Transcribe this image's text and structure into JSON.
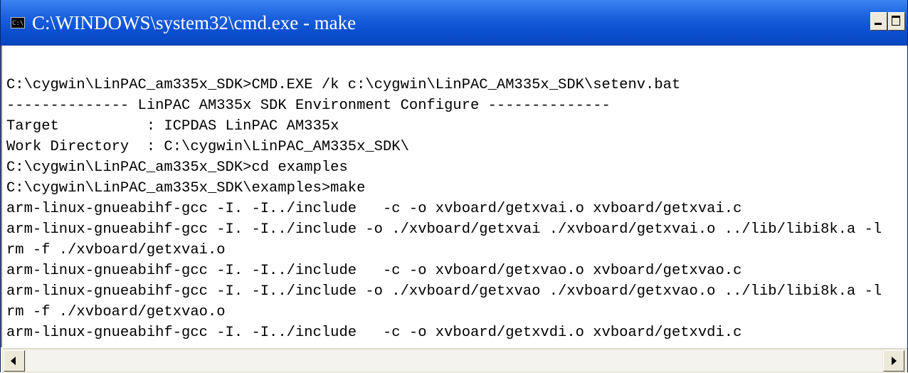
{
  "window": {
    "title": "C:\\WINDOWS\\system32\\cmd.exe - make",
    "icon_text": "C:\\"
  },
  "console": {
    "lines": [
      "",
      "C:\\cygwin\\LinPAC_am335x_SDK>CMD.EXE /k c:\\cygwin\\LinPAC_AM335x_SDK\\setenv.bat",
      "-------------- LinPAC AM335x SDK Environment Configure --------------",
      "Target          : ICPDAS LinPAC AM335x",
      "Work Directory  : C:\\cygwin\\LinPAC_AM335x_SDK\\",
      "C:\\cygwin\\LinPAC_am335x_SDK>cd examples",
      "C:\\cygwin\\LinPAC_am335x_SDK\\examples>make",
      "arm-linux-gnueabihf-gcc -I. -I../include   -c -o xvboard/getxvai.o xvboard/getxvai.c",
      "arm-linux-gnueabihf-gcc -I. -I../include -o ./xvboard/getxvai ./xvboard/getxvai.o ../lib/libi8k.a -l",
      "rm -f ./xvboard/getxvai.o",
      "arm-linux-gnueabihf-gcc -I. -I../include   -c -o xvboard/getxvao.o xvboard/getxvao.c",
      "arm-linux-gnueabihf-gcc -I. -I../include -o ./xvboard/getxvao ./xvboard/getxvao.o ../lib/libi8k.a -l",
      "rm -f ./xvboard/getxvao.o",
      "arm-linux-gnueabihf-gcc -I. -I../include   -c -o xvboard/getxvdi.o xvboard/getxvdi.c"
    ]
  },
  "icons": {
    "app": "cmd-console-icon",
    "minimize": "minimize-icon",
    "maximize": "maximize-icon",
    "scroll_left": "scroll-left-arrow-icon",
    "scroll_right": "scroll-right-arrow-icon"
  },
  "colors": {
    "titlebar": "#0b4fd0",
    "console_bg": "#ffffff",
    "console_fg": "#000000"
  }
}
